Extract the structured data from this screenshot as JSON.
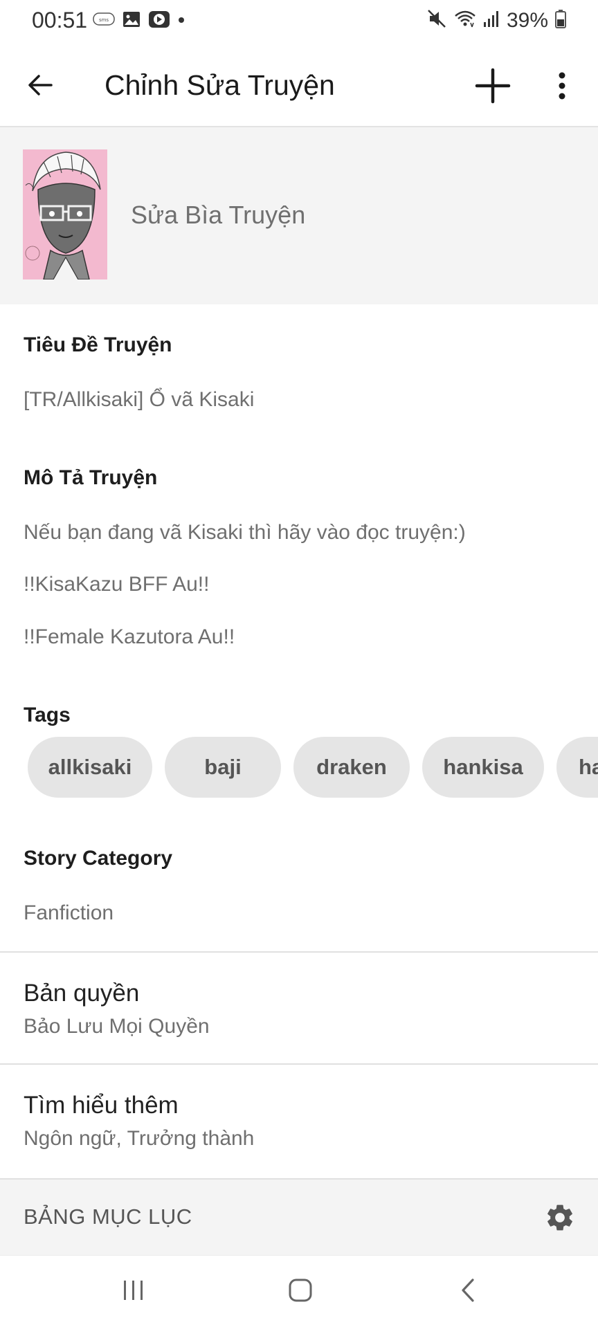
{
  "status_bar": {
    "time": "00:51",
    "battery": "39%",
    "icons": [
      "sms-icon",
      "gallery-icon",
      "youtube-icon",
      "notification-dot-icon",
      "mute-icon",
      "wifi-icon",
      "signal-icon",
      "battery-icon"
    ]
  },
  "app_bar": {
    "title": "Chỉnh Sửa Truyện",
    "icons": [
      "back-arrow-icon",
      "plus-icon",
      "more-vertical-icon"
    ]
  },
  "cover": {
    "edit_label": "Sửa Bìa Truyện"
  },
  "story_title": {
    "label": "Tiêu Đề Truyện",
    "value": "[TR/Allkisaki] Ổ vã Kisaki"
  },
  "description": {
    "label": "Mô Tả Truyện",
    "lines": [
      "Nếu bạn đang vã Kisaki thì hãy vào đọc truyện:)",
      "!!KisaKazu BFF Au!!",
      "!!Female Kazutora Au!!"
    ]
  },
  "tags": {
    "label": "Tags",
    "items": [
      "allkisaki",
      "baji",
      "draken",
      "hankisa",
      "ha"
    ]
  },
  "category": {
    "label": "Story Category",
    "value": "Fanfiction"
  },
  "copyright": {
    "title": "Bản quyền",
    "value": "Bảo Lưu Mọi Quyền"
  },
  "more_info": {
    "title": "Tìm hiểu thêm",
    "value": "Ngôn ngữ, Trưởng thành"
  },
  "toc": {
    "label": "BẢNG MỤC LỤC",
    "icon": "gear-icon"
  },
  "nav_bar": {
    "icons": [
      "recent-apps-icon",
      "home-icon",
      "back-icon"
    ]
  },
  "colors": {
    "background": "#ffffff",
    "section_background": "#f4f4f4",
    "chip_background": "#e5e5e5",
    "muted_text": "#6f6f6f",
    "cover_pink": "#f3b9cf"
  }
}
